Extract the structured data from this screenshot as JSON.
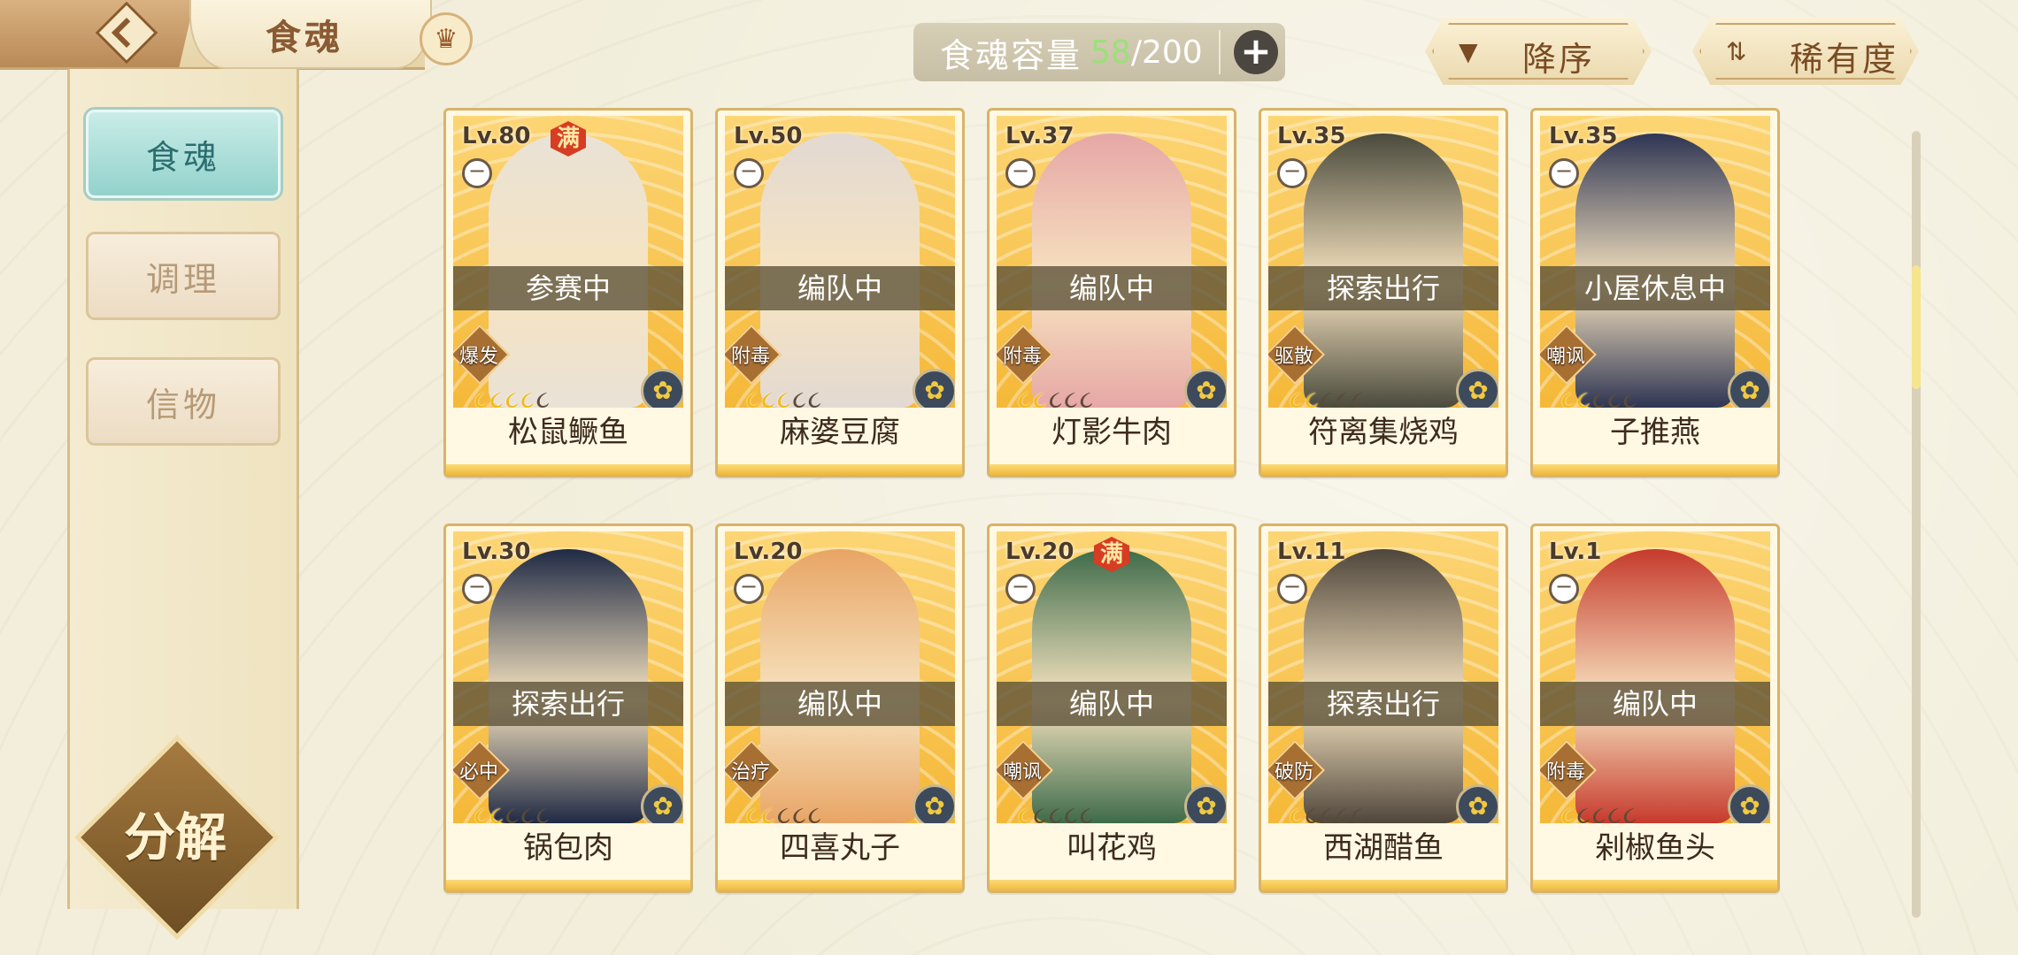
{
  "header": {
    "title": "食魂",
    "capacity_label": "食魂容量",
    "capacity_current": "58",
    "capacity_separator": "/",
    "capacity_max": "200",
    "add_icon": "plus-icon",
    "sort_order_label": "降序",
    "sort_rarity_label": "稀有度"
  },
  "sidebar": {
    "items": [
      {
        "label": "食魂",
        "active": true
      },
      {
        "label": "调理",
        "active": false
      },
      {
        "label": "信物",
        "active": false
      }
    ],
    "decompose_label": "分解"
  },
  "cards": [
    {
      "level": "Lv.80",
      "full": true,
      "full_label": "满",
      "status": "参赛中",
      "role": "爆发",
      "stars_lit": 4,
      "stars_total": 5,
      "name": "松鼠鳜鱼",
      "portrait_color": "#e9e2d6"
    },
    {
      "level": "Lv.50",
      "full": false,
      "full_label": "",
      "status": "编队中",
      "role": "附毒",
      "stars_lit": 3,
      "stars_total": 5,
      "name": "麻婆豆腐",
      "portrait_color": "#e2d9d2"
    },
    {
      "level": "Lv.37",
      "full": false,
      "full_label": "",
      "status": "编队中",
      "role": "附毒",
      "stars_lit": 2,
      "stars_total": 5,
      "name": "灯影牛肉",
      "portrait_color": "#e6a7a6"
    },
    {
      "level": "Lv.35",
      "full": false,
      "full_label": "",
      "status": "探索出行",
      "role": "驱散",
      "stars_lit": 2,
      "stars_total": 5,
      "name": "符离集烧鸡",
      "portrait_color": "#4a4a3c"
    },
    {
      "level": "Lv.35",
      "full": false,
      "full_label": "",
      "status": "小屋休息中",
      "role": "嘲讽",
      "stars_lit": 2,
      "stars_total": 5,
      "name": "子推燕",
      "portrait_color": "#2e3553"
    },
    {
      "level": "Lv.30",
      "full": false,
      "full_label": "",
      "status": "探索出行",
      "role": "必中",
      "stars_lit": 2,
      "stars_total": 5,
      "name": "锅包肉",
      "portrait_color": "#1f2a44"
    },
    {
      "level": "Lv.20",
      "full": false,
      "full_label": "",
      "status": "编队中",
      "role": "治疗",
      "stars_lit": 2,
      "stars_total": 5,
      "name": "四喜丸子",
      "portrait_color": "#e8a565"
    },
    {
      "level": "Lv.20",
      "full": true,
      "full_label": "满",
      "status": "编队中",
      "role": "嘲讽",
      "stars_lit": 1,
      "stars_total": 5,
      "name": "叫花鸡",
      "portrait_color": "#3e6b4a"
    },
    {
      "level": "Lv.11",
      "full": false,
      "full_label": "",
      "status": "探索出行",
      "role": "破防",
      "stars_lit": 1,
      "stars_total": 5,
      "name": "西湖醋鱼",
      "portrait_color": "#4f463b"
    },
    {
      "level": "Lv.1",
      "full": false,
      "full_label": "",
      "status": "编队中",
      "role": "附毒",
      "stars_lit": 1,
      "stars_total": 5,
      "name": "剁椒鱼头",
      "portrait_color": "#c63a2c"
    }
  ],
  "colors": {
    "active_tab": "#93d2cc",
    "star_lit": "#f2b918",
    "star_dim": "#5c4a38",
    "capacity_current": "#9be07a"
  }
}
